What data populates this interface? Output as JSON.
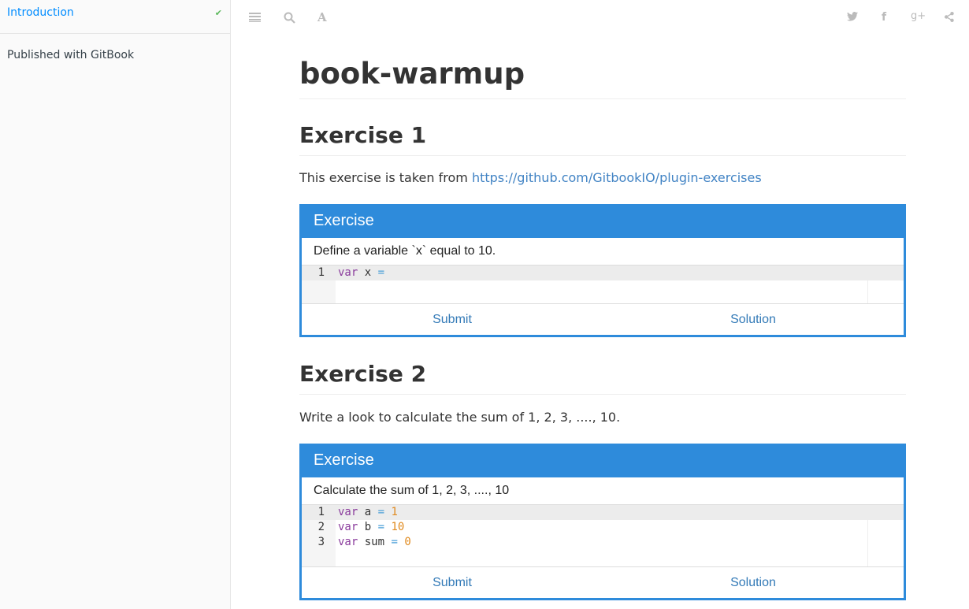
{
  "sidebar": {
    "items": [
      {
        "label": "Introduction",
        "active": true
      }
    ],
    "footer": "Published with GitBook"
  },
  "toolbar": {
    "left": [
      "menu-icon",
      "search-icon",
      "font-settings-icon"
    ],
    "right": [
      "twitter-icon",
      "facebook-icon",
      "google-plus-icon",
      "share-icon"
    ]
  },
  "page": {
    "title": "book-warmup",
    "sections": [
      {
        "heading": "Exercise 1",
        "text": "This exercise is taken from ",
        "link": "https://github.com/GitbookIO/plugin-exercises",
        "exercise": {
          "header": "Exercise",
          "description": "Define a variable `x` equal to 10.",
          "code": [
            "var x ="
          ],
          "submit": "Submit",
          "solution": "Solution"
        }
      },
      {
        "heading": "Exercise 2",
        "text": "Write a look to calculate the sum of 1, 2, 3, ...., 10.",
        "exercise": {
          "header": "Exercise",
          "description": "Calculate the sum of 1, 2, 3, ...., 10",
          "code": [
            "var a = 1",
            "var b = 10",
            "var sum = 0"
          ],
          "submit": "Submit",
          "solution": "Solution"
        }
      }
    ]
  },
  "colors": {
    "accent": "#2e8bdb",
    "link": "#4183c4",
    "active_nav": "#008cff",
    "check": "#5cb85c",
    "keyword": "#8a3b9c",
    "number": "#e08a1e"
  }
}
